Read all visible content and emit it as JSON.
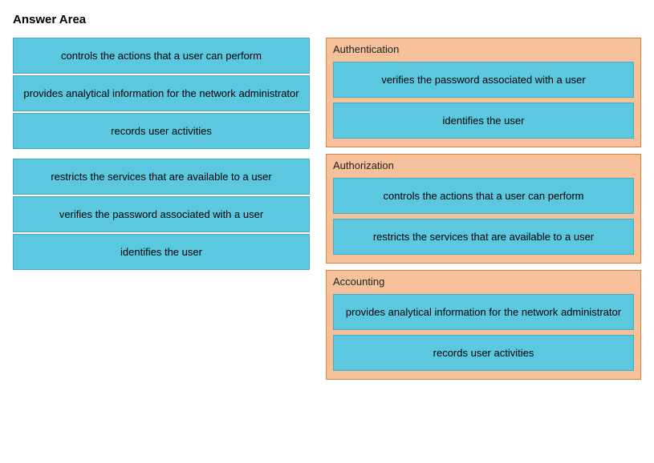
{
  "title": "Answer Area",
  "left_column": {
    "items": [
      {
        "id": "item-controls",
        "text": "controls the actions that a user can perform"
      },
      {
        "id": "item-provides",
        "text": "provides analytical information for the network administrator"
      },
      {
        "id": "item-records",
        "text": "records user activities"
      },
      {
        "id": "item-restricts",
        "text": "restricts the services that are available to a user"
      },
      {
        "id": "item-verifies",
        "text": "verifies the password associated with a user"
      },
      {
        "id": "item-identifies",
        "text": "identifies the user"
      }
    ]
  },
  "right_column": {
    "categories": [
      {
        "id": "authentication",
        "title": "Authentication",
        "items": [
          {
            "id": "auth-verifies",
            "text": "verifies the password associated with a user"
          },
          {
            "id": "auth-identifies",
            "text": "identifies the user"
          }
        ]
      },
      {
        "id": "authorization",
        "title": "Authorization",
        "items": [
          {
            "id": "authz-controls",
            "text": "controls the actions that a user can perform"
          },
          {
            "id": "authz-restricts",
            "text": "restricts the services that are available to a user"
          }
        ]
      },
      {
        "id": "accounting",
        "title": "Accounting",
        "items": [
          {
            "id": "acct-provides",
            "text": "provides analytical information for the network administrator"
          },
          {
            "id": "acct-records",
            "text": "records user activities"
          }
        ]
      }
    ]
  }
}
